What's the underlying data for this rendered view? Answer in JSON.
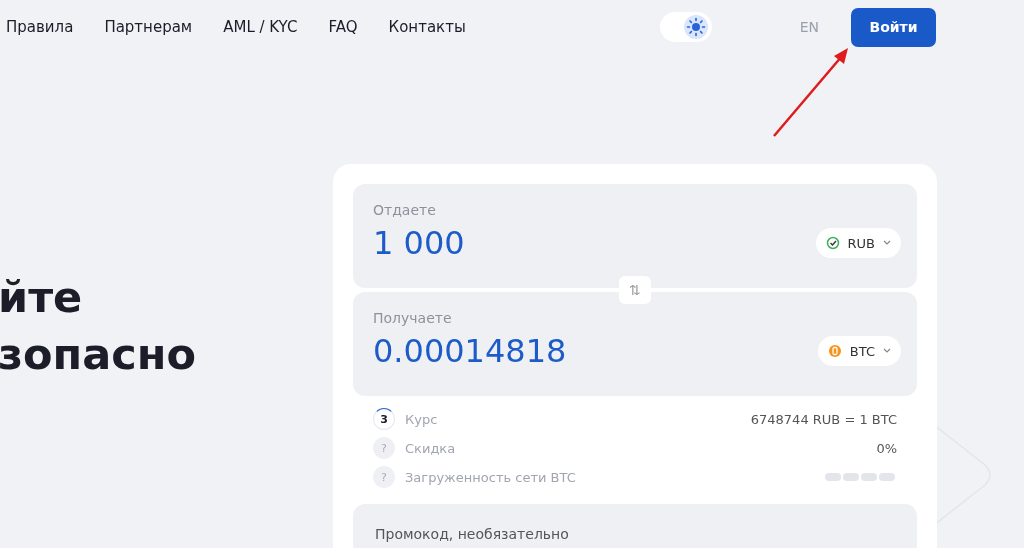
{
  "nav": {
    "links": [
      "Правила",
      "Партнерам",
      "AML / KYC",
      "FAQ",
      "Контакты"
    ],
    "theme_toggle": {
      "on": true
    },
    "language": "EN",
    "login": "Войти"
  },
  "hero": {
    "lines": [
      "йте",
      "зопасно"
    ]
  },
  "exchange": {
    "give": {
      "label": "Отдаете",
      "amount": "1 000",
      "currency": "RUB"
    },
    "swap_icon": "⇅",
    "get": {
      "label": "Получаете",
      "amount": "0.00014818",
      "currency": "BTC"
    },
    "info": [
      {
        "kind": "timer",
        "badge": "3",
        "label": "Курс",
        "value": "6748744 RUB = 1 BTC"
      },
      {
        "kind": "help",
        "badge": "?",
        "label": "Скидка",
        "value": "0%"
      },
      {
        "kind": "load",
        "badge": "?",
        "label": "Загруженность сети BTC"
      }
    ],
    "promo": {
      "placeholder": "Промокод, необязательно"
    }
  }
}
